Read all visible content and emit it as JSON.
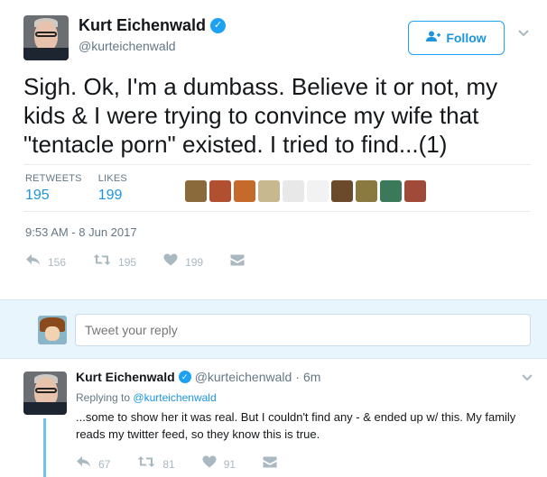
{
  "tweet": {
    "author_name": "Kurt Eichenwald",
    "author_handle": "@kurteichenwald",
    "follow_label": "Follow",
    "text": "Sigh. Ok, I'm a dumbass. Believe it or not, my kids & I were trying to convince my wife that \"tentacle porn\" existed. I tried to find...(1)",
    "retweets_label": "RETWEETS",
    "retweets_count": "195",
    "likes_label": "LIKES",
    "likes_count": "199",
    "timestamp": "9:53 AM - 8 Jun 2017",
    "actions": {
      "reply_count": "156",
      "retweet_count": "195",
      "like_count": "199"
    }
  },
  "reply_box": {
    "placeholder": "Tweet your reply"
  },
  "reply_tweet": {
    "author_name": "Kurt Eichenwald",
    "author_handle": "@kurteichenwald",
    "separator": "·",
    "time": "6m",
    "replying_prefix": "Replying to",
    "replying_to": "@kurteichenwald",
    "text": "...some to show her it was real. But I couldn't find any - & ended up w/ this. My family reads my twitter feed, so they know this is true.",
    "actions": {
      "reply_count": "67",
      "retweet_count": "81",
      "like_count": "91"
    }
  },
  "likers": [
    {
      "color": "#8a6a3a"
    },
    {
      "color": "#b05030"
    },
    {
      "color": "#c46a2a"
    },
    {
      "color": "#c8b890"
    },
    {
      "color": "#e8e8e8"
    },
    {
      "color": "#f2f2f2"
    },
    {
      "color": "#6a4a2a"
    },
    {
      "color": "#8a7a40"
    },
    {
      "color": "#3a7a5a"
    },
    {
      "color": "#a04a3a"
    }
  ],
  "colors": {
    "accent": "#1da1f2",
    "link": "#1b95e0",
    "muted": "#657786",
    "thread_line": "#6cc3ec"
  }
}
